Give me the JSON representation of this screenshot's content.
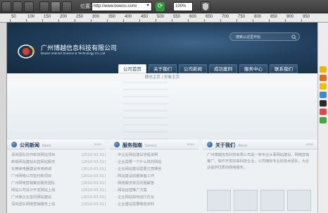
{
  "browser": {
    "address_label": "位置:",
    "url": "http://www.bowos.com/",
    "zoom": "100%"
  },
  "ruler": {
    "ticks": [
      "50",
      "100",
      "150",
      "200",
      "250",
      "300",
      "350",
      "400",
      "450",
      "500",
      "550",
      "600",
      "650",
      "700",
      "750",
      "800",
      "850",
      "900",
      "950"
    ]
  },
  "site": {
    "company_cn": "广州博越信息科技有限公司",
    "company_en": "Bowos Internet Science & Technology Co.,Ltd",
    "search_placeholder": "搜索从这里开始",
    "nav": [
      "公司首页",
      "关于我们",
      "公司新闻",
      "成功案例",
      "服务中心",
      "联系我们"
    ],
    "breadcrumb": "静态主页 | 形象主页",
    "sections": {
      "news": {
        "title": "公司新闻",
        "en": "News",
        "more": "more",
        "items": [
          {
            "title": "深圳团队协作新增网站项目",
            "date": "[2010-03-31]"
          },
          {
            "title": "新版网站建站出售网站服务",
            "date": "[2010-03-31]"
          },
          {
            "title": "东莞某电器建设专用商城",
            "date": "[2010-03-31]"
          },
          {
            "title": "广州网络公司签约新项目",
            "date": "[2010-03-31]"
          },
          {
            "title": "广州网络营销策划服务团队",
            "date": "[2010-03-31]"
          },
          {
            "title": "网站公司设计开发网站上线",
            "date": "[2010-03-31]"
          },
          {
            "title": "广州某企业签约网站建设",
            "date": "[2010-03-31]"
          },
          {
            "title": "深圳团队网络营销服务上线",
            "date": "[2010-03-31]"
          }
        ]
      },
      "services": {
        "title": "服务指南",
        "en": "Service",
        "more": "more",
        "items": [
          "中企业网站建设流程说明",
          "企业需要一个什么样的网站",
          "企业网站建设需要注意哪些",
          "网站建设前期准备工作",
          "网络服务常见问题解答",
          "网站运营推广方案",
          "企业网站如何进行优化",
          "企业建站需要哪些资料"
        ]
      },
      "about": {
        "title": "关于我们",
        "en": "About",
        "more": "more",
        "text": "广州博越信息科技有限公司是一家专业从事网站建设、网络营销推广、软件开发的高科技企业，公司拥有专业的技术团队，为企业提供优质的网络服务。"
      }
    }
  }
}
